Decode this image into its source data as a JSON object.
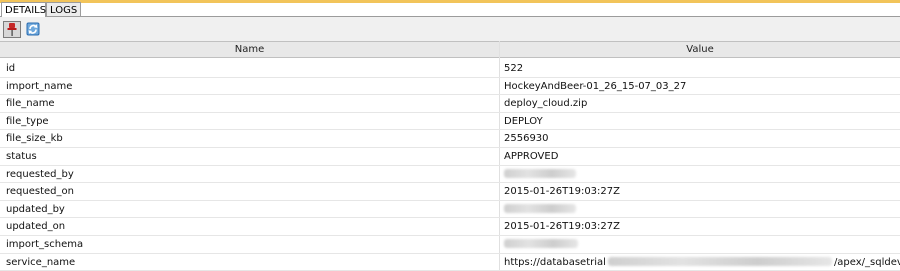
{
  "tabs": [
    {
      "label": "DETAILS",
      "active": true
    },
    {
      "label": "LOGS",
      "active": false
    }
  ],
  "toolbar": {
    "pin_icon": "pin-icon",
    "refresh_icon": "refresh-icon"
  },
  "table": {
    "columns": [
      "Name",
      "Value"
    ],
    "rows": [
      {
        "name": "id",
        "value": "522"
      },
      {
        "name": "import_name",
        "value": "HockeyAndBeer-01_26_15-07_03_27"
      },
      {
        "name": "file_name",
        "value": "deploy_cloud.zip"
      },
      {
        "name": "file_type",
        "value": "DEPLOY"
      },
      {
        "name": "file_size_kb",
        "value": "2556930"
      },
      {
        "name": "status",
        "value": "APPROVED"
      },
      {
        "name": "requested_by",
        "value": ""
      },
      {
        "name": "requested_on",
        "value": "2015-01-26T19:03:27Z"
      },
      {
        "name": "updated_by",
        "value": ""
      },
      {
        "name": "updated_on",
        "value": "2015-01-26T19:03:27Z"
      },
      {
        "name": "import_schema",
        "value": ""
      },
      {
        "name": "service_name",
        "value_prefix": "https://databasetrial",
        "value_suffix": "/apex/_sqldev/"
      }
    ]
  },
  "colors": {
    "accent": "#f2c45a",
    "header_bg": "#e8e8e8",
    "toolbar_bg": "#f0f0f0"
  }
}
